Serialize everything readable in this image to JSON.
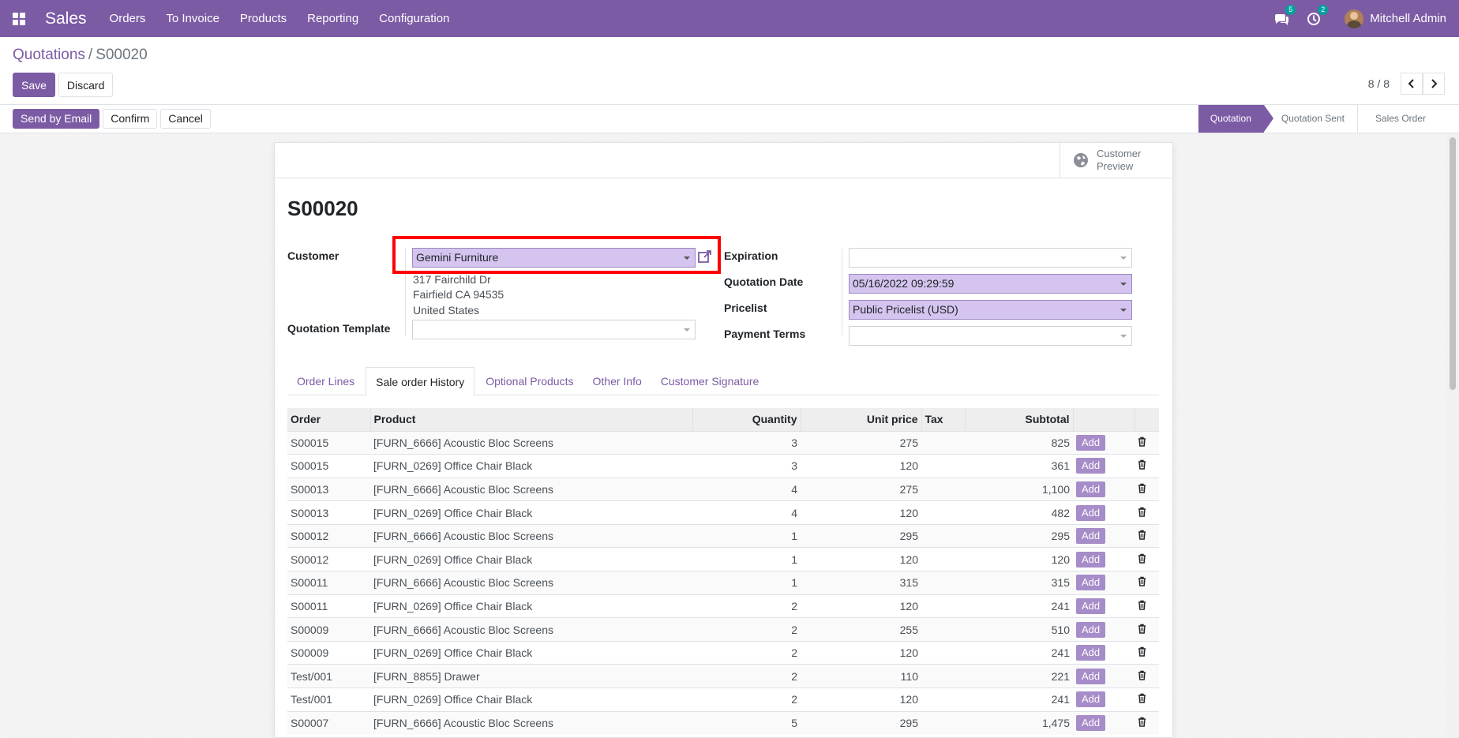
{
  "navbar": {
    "app_name": "Sales",
    "menu": [
      "Orders",
      "To Invoice",
      "Products",
      "Reporting",
      "Configuration"
    ],
    "messages_badge": "5",
    "activities_badge": "2",
    "user": "Mitchell Admin"
  },
  "breadcrumb": {
    "parent": "Quotations",
    "separator": "/",
    "current": "S00020"
  },
  "control": {
    "save": "Save",
    "discard": "Discard",
    "pager": "8 / 8"
  },
  "statusbar": {
    "buttons": [
      "Send by Email",
      "Confirm",
      "Cancel"
    ],
    "stages": [
      "Quotation",
      "Quotation Sent",
      "Sales Order"
    ],
    "active_stage": "Quotation"
  },
  "sheet": {
    "preview_label": "Customer Preview",
    "title": "S00020",
    "fields": {
      "customer_label": "Customer",
      "customer_value": "Gemini Furniture",
      "address": [
        "317 Fairchild Dr",
        "Fairfield CA 94535",
        "United States"
      ],
      "template_label": "Quotation Template",
      "template_value": "",
      "expiration_label": "Expiration",
      "expiration_value": "",
      "date_label": "Quotation Date",
      "date_value": "05/16/2022 09:29:59",
      "pricelist_label": "Pricelist",
      "pricelist_value": "Public Pricelist (USD)",
      "terms_label": "Payment Terms",
      "terms_value": ""
    },
    "tabs": [
      "Order Lines",
      "Sale order History",
      "Optional Products",
      "Other Info",
      "Customer Signature"
    ],
    "active_tab": "Sale order History"
  },
  "history": {
    "columns": [
      "Order",
      "Product",
      "Quantity",
      "Unit price",
      "Tax",
      "Subtotal"
    ],
    "add_label": "Add",
    "rows": [
      {
        "order": "S00015",
        "product": "[FURN_6666] Acoustic Bloc Screens",
        "qty": "3",
        "price": "275",
        "tax": "",
        "subtotal": "825"
      },
      {
        "order": "S00015",
        "product": "[FURN_0269] Office Chair Black",
        "qty": "3",
        "price": "120",
        "tax": "",
        "subtotal": "361"
      },
      {
        "order": "S00013",
        "product": "[FURN_6666] Acoustic Bloc Screens",
        "qty": "4",
        "price": "275",
        "tax": "",
        "subtotal": "1,100"
      },
      {
        "order": "S00013",
        "product": "[FURN_0269] Office Chair Black",
        "qty": "4",
        "price": "120",
        "tax": "",
        "subtotal": "482"
      },
      {
        "order": "S00012",
        "product": "[FURN_6666] Acoustic Bloc Screens",
        "qty": "1",
        "price": "295",
        "tax": "",
        "subtotal": "295"
      },
      {
        "order": "S00012",
        "product": "[FURN_0269] Office Chair Black",
        "qty": "1",
        "price": "120",
        "tax": "",
        "subtotal": "120"
      },
      {
        "order": "S00011",
        "product": "[FURN_6666] Acoustic Bloc Screens",
        "qty": "1",
        "price": "315",
        "tax": "",
        "subtotal": "315"
      },
      {
        "order": "S00011",
        "product": "[FURN_0269] Office Chair Black",
        "qty": "2",
        "price": "120",
        "tax": "",
        "subtotal": "241"
      },
      {
        "order": "S00009",
        "product": "[FURN_6666] Acoustic Bloc Screens",
        "qty": "2",
        "price": "255",
        "tax": "",
        "subtotal": "510"
      },
      {
        "order": "S00009",
        "product": "[FURN_0269] Office Chair Black",
        "qty": "2",
        "price": "120",
        "tax": "",
        "subtotal": "241"
      },
      {
        "order": "Test/001",
        "product": "[FURN_8855] Drawer",
        "qty": "2",
        "price": "110",
        "tax": "",
        "subtotal": "221"
      },
      {
        "order": "Test/001",
        "product": "[FURN_0269] Office Chair Black",
        "qty": "2",
        "price": "120",
        "tax": "",
        "subtotal": "241"
      },
      {
        "order": "S00007",
        "product": "[FURN_6666] Acoustic Bloc Screens",
        "qty": "5",
        "price": "295",
        "tax": "",
        "subtotal": "1,475"
      }
    ]
  },
  "colors": {
    "brand": "#7c5ba5",
    "highlight": "#ff0000",
    "filled_field": "#d4c4ef"
  }
}
